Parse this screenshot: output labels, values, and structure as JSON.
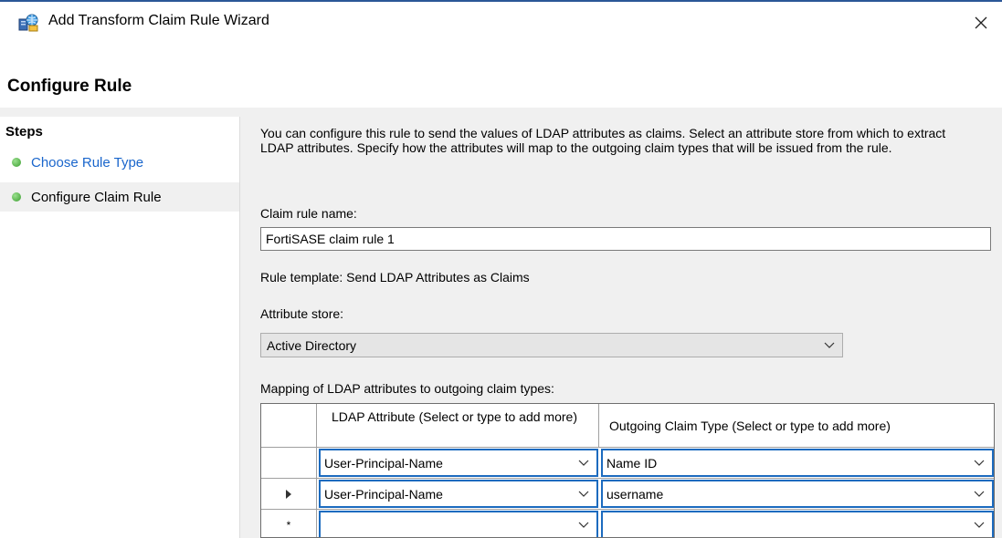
{
  "window": {
    "title": "Add Transform Claim Rule Wizard",
    "app_icon": "server-network-icon",
    "close_icon": "close-icon",
    "accent_color": "#2b5797"
  },
  "header": {
    "page_title": "Configure Rule"
  },
  "sidebar": {
    "heading": "Steps",
    "items": [
      {
        "label": "Choose Rule Type",
        "state": "link",
        "color": "#1a66cc"
      },
      {
        "label": "Configure Claim Rule",
        "state": "current"
      }
    ]
  },
  "main": {
    "intro": "You can configure this rule to send the values of LDAP attributes as claims. Select an attribute store from which to extract LDAP attributes. Specify how the attributes will map to the outgoing claim types that will be issued from the rule.",
    "claim_rule_name_label": "Claim rule name:",
    "claim_rule_name_value": "FortiSASE claim rule 1",
    "rule_template": "Rule template: Send LDAP Attributes as Claims",
    "attribute_store_label": "Attribute store:",
    "attribute_store_value": "Active Directory",
    "mapping_label": "Mapping of LDAP attributes to outgoing claim types:",
    "grid": {
      "columns": [
        "LDAP Attribute (Select or type to add more)",
        "Outgoing Claim Type (Select or type to add more)"
      ],
      "rows": [
        {
          "marker": "",
          "ldap": "User-Principal-Name",
          "claim": "Name ID"
        },
        {
          "marker": "current-row-arrow",
          "ldap": "User-Principal-Name",
          "claim": "username"
        },
        {
          "marker": "*",
          "ldap": "",
          "claim": ""
        }
      ]
    }
  }
}
